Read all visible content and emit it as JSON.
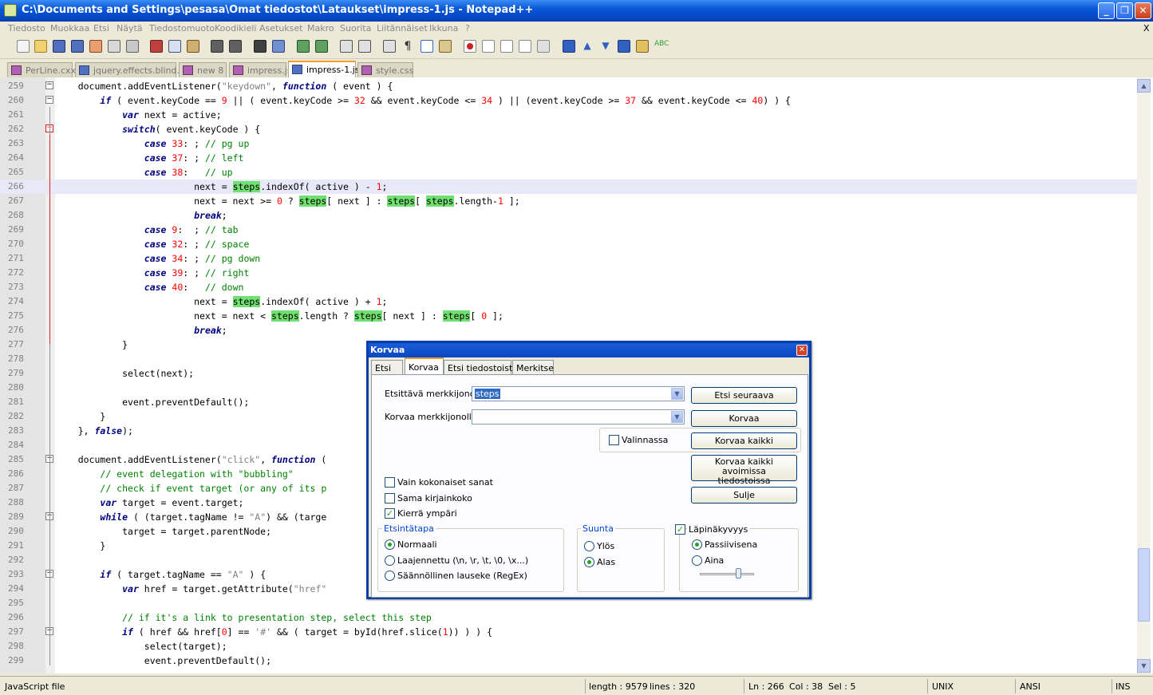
{
  "window": {
    "title": "C:\\Documents and Settings\\pesasa\\Omat tiedostot\\Lataukset\\impress-1.js - Notepad++",
    "minimize": "_",
    "restore": "❐",
    "close": "✕"
  },
  "menu": [
    "Tiedosto",
    "Muokkaa",
    "Etsi",
    "Näytä",
    "Tiedostomuoto",
    "Koodikieli",
    "Asetukset",
    "Makro",
    "Suorita",
    "Liitännäiset",
    "Ikkuna",
    "?"
  ],
  "menu_close": "X",
  "tabs": [
    {
      "label": "PerLine.cxx"
    },
    {
      "label": "jquery.effects.blind.js"
    },
    {
      "label": "new  8"
    },
    {
      "label": "impress.js"
    },
    {
      "label": "impress-1.js"
    },
    {
      "label": "style.css"
    }
  ],
  "editor": {
    "first_line": 259,
    "current_line": 266,
    "line_numbers": [
      "259",
      "260",
      "261",
      "262",
      "263",
      "264",
      "265",
      "266",
      "267",
      "268",
      "269",
      "270",
      "271",
      "272",
      "273",
      "274",
      "275",
      "276",
      "277",
      "278",
      "279",
      "280",
      "281",
      "282",
      "283",
      "284",
      "285",
      "286",
      "287",
      "288",
      "289",
      "290",
      "291",
      "292",
      "293",
      "294",
      "295",
      "296",
      "297",
      "298",
      "299"
    ]
  },
  "dialog": {
    "title": "Korvaa",
    "close": "✕",
    "tabs": [
      "Etsi",
      "Korvaa",
      "Etsi tiedostoista",
      "Merkitse"
    ],
    "active_tab": "Korvaa",
    "find_label": "Etsittävä merkkijono:",
    "find_value": "steps",
    "replace_label": "Korvaa merkkijonolla:",
    "replace_value": "",
    "in_selection": "Valinnassa",
    "buttons": {
      "find_next": "Etsi seuraava",
      "replace": "Korvaa",
      "replace_all": "Korvaa kaikki",
      "replace_all_open_line1": "Korvaa kaikki avoimissa",
      "replace_all_open_line2": "tiedostoissa",
      "close": "Sulje"
    },
    "options": [
      {
        "label": "Vain kokonaiset sanat",
        "checked": false
      },
      {
        "label": "Sama kirjainkoko",
        "checked": false
      },
      {
        "label": "Kierrä ympäri",
        "checked": true
      }
    ],
    "search_mode": {
      "title": "Etsintätapa",
      "items": [
        "Normaali",
        "Laajennettu (\\n, \\r, \\t, \\0, \\x...)",
        "Säännöllinen lauseke (RegEx)"
      ],
      "selected": 0
    },
    "direction": {
      "title": "Suunta",
      "items": [
        "Ylös",
        "Alas"
      ],
      "selected": 1
    },
    "transparency": {
      "title": "Läpinäkyvyys",
      "checked": true,
      "items": [
        "Passiivisena",
        "Aina"
      ],
      "selected": 0
    }
  },
  "status": {
    "filetype": "JavaScript file",
    "length": "length : 9579",
    "lines": "lines : 320",
    "ln": "Ln : 266",
    "col": "Col : 38",
    "sel": "Sel : 5",
    "eol": "UNIX",
    "encoding": "ANSI",
    "mode": "INS"
  }
}
